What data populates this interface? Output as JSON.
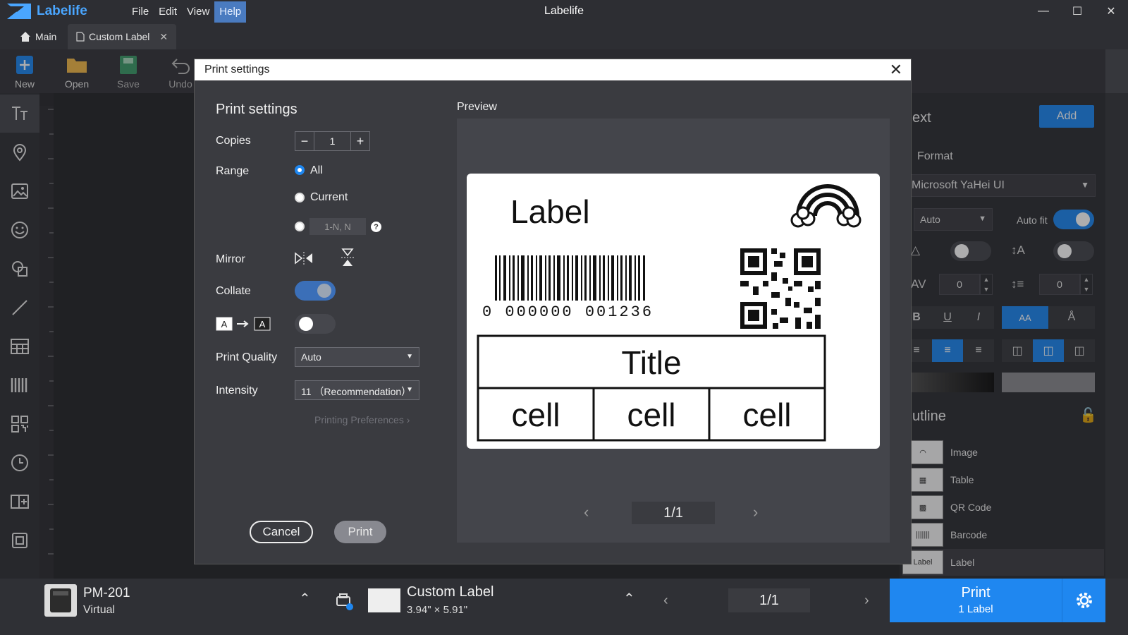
{
  "app": {
    "logo_text": "Labelife",
    "title": "Labelife",
    "menu": [
      "File",
      "Edit",
      "View",
      "Help"
    ],
    "active_menu": "Help",
    "window_controls": [
      "minimize-icon",
      "maximize-icon",
      "close-icon"
    ]
  },
  "tabs": {
    "main": "Main",
    "custom": "Custom Label"
  },
  "toolbar": {
    "new": "New",
    "open": "Open",
    "save": "Save",
    "undo": "Undo"
  },
  "left_tools": [
    "text-icon",
    "location-icon",
    "image-icon",
    "emoji-icon",
    "shape-icon",
    "line-icon",
    "table-icon",
    "barcode-icon",
    "qrcode-icon",
    "clock-icon",
    "serial-icon",
    "frame-icon"
  ],
  "right_panel": {
    "title": "ext",
    "add": "Add",
    "format": "Format",
    "font": "Microsoft YaHei UI",
    "size": "Auto",
    "auto_fit": "Auto fit",
    "letter_spacing": "0",
    "line_spacing": "0",
    "case_label": "AA",
    "outline_title": "utline",
    "outline_items": [
      {
        "label": "Image",
        "thumb": "rainbow"
      },
      {
        "label": "Table",
        "thumb": "table"
      },
      {
        "label": "QR Code",
        "thumb": "qr"
      },
      {
        "label": "Barcode",
        "thumb": "barcode"
      },
      {
        "label": "Label",
        "thumb": "Label"
      }
    ]
  },
  "bottom": {
    "printer_name": "PM-201",
    "printer_mode": "Virtual",
    "paper_name": "Custom Label",
    "paper_size": "3.94\" × 5.91\"",
    "page": "1/1",
    "print_label": "Print",
    "print_count": "1 Label"
  },
  "dialog": {
    "title": "Print settings",
    "heading": "Print settings",
    "copies_label": "Copies",
    "copies_value": "1",
    "range_label": "Range",
    "range_all": "All",
    "range_current": "Current",
    "range_custom_placeholder": "1-N, N",
    "range_selected": "All",
    "mirror_label": "Mirror",
    "collate_label": "Collate",
    "collate_on": true,
    "invert_on": false,
    "quality_label": "Print Quality",
    "quality_value": "Auto",
    "intensity_label": "Intensity",
    "intensity_value": "11 （Recommendation）",
    "preferences_link": "Printing Preferences",
    "cancel": "Cancel",
    "print": "Print",
    "preview_label": "Preview",
    "preview_page": "1/1"
  },
  "label_preview": {
    "heading": "Label",
    "barcode_digits": "0 000000 001236",
    "table_title": "Title",
    "cells": [
      "cell",
      "cell",
      "cell"
    ]
  },
  "colors": {
    "accent": "#1f87f0",
    "background": "#2b2c30",
    "dialog_bg": "#3a3b40"
  }
}
